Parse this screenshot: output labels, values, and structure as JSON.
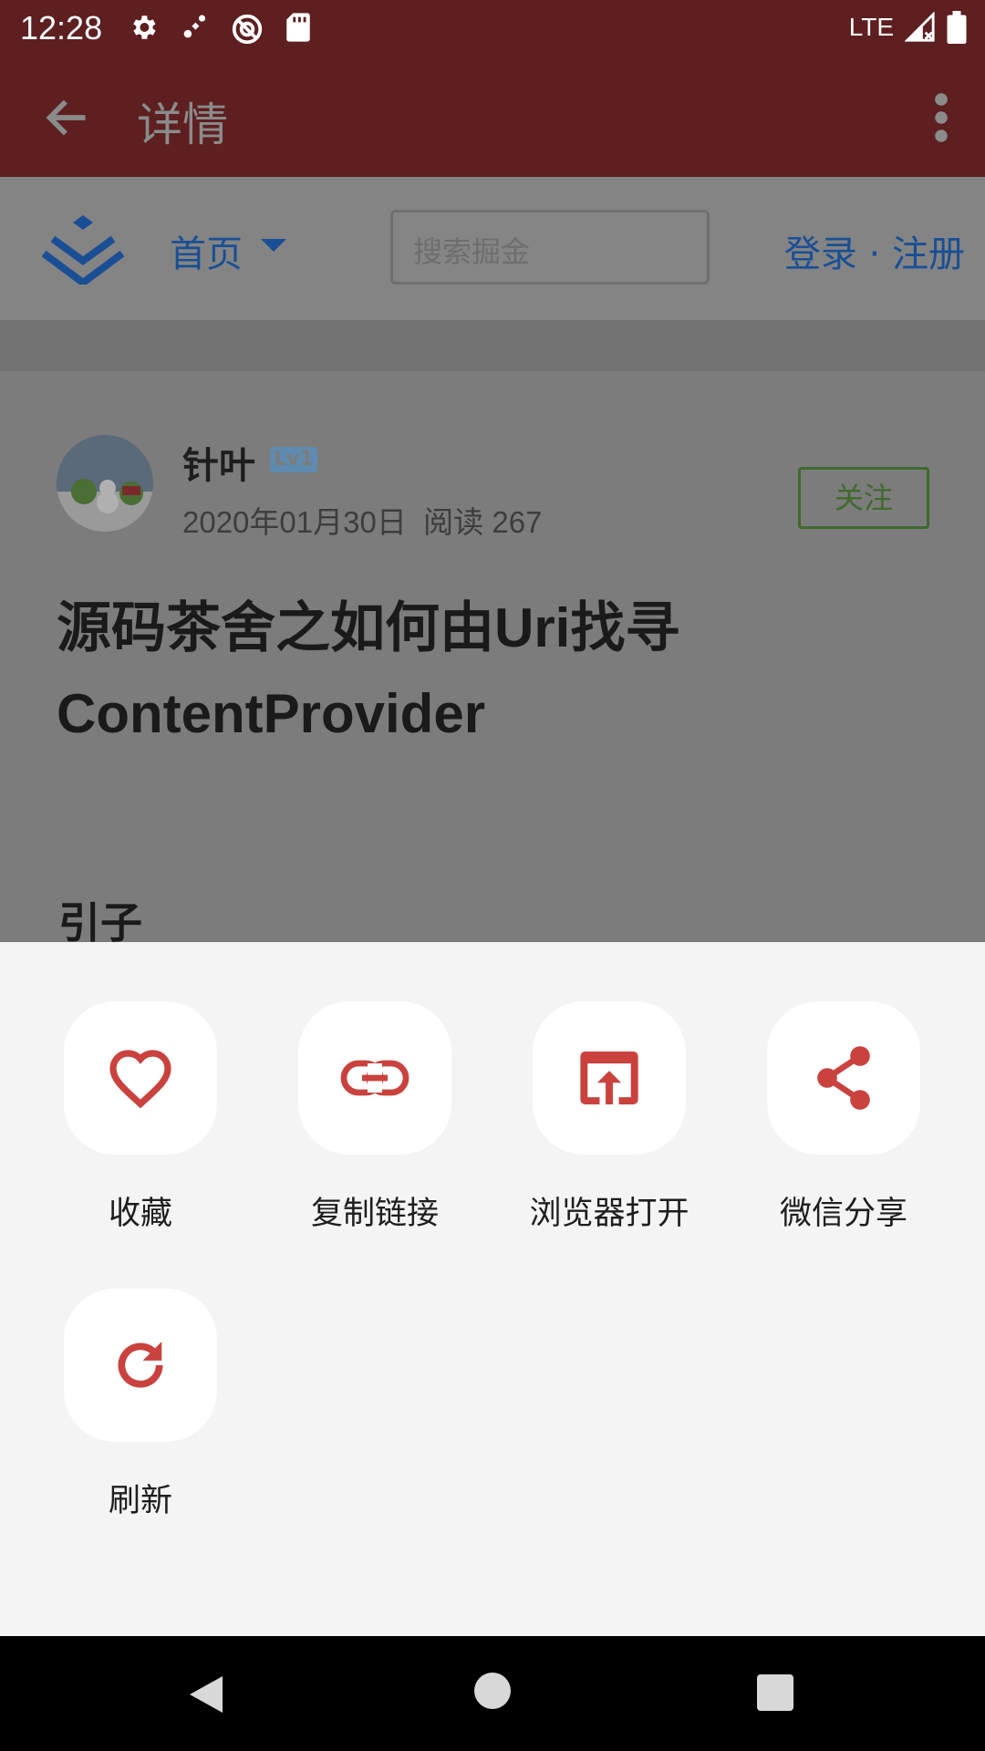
{
  "status_bar": {
    "time": "12:28",
    "network": "LTE",
    "icons_left": [
      "settings-icon",
      "signal-icon",
      "vpn-icon",
      "sd-card-icon"
    ],
    "icons_right": [
      "cell-signal-icon",
      "battery-icon"
    ]
  },
  "toolbar": {
    "title": "详情",
    "back_icon": "arrow-back-icon",
    "menu_icon": "more-vert-icon"
  },
  "site_header": {
    "home_label": "首页",
    "search_placeholder": "搜索掘金",
    "auth_label": "登录 · 注册"
  },
  "article": {
    "author_name": "针叶",
    "level_badge": "Lv1",
    "date": "2020年01月30日",
    "read_label": "阅读 267",
    "follow_label": "关注",
    "title": "源码茶舍之如何由Uri找寻ContentProvider",
    "section_heading": "引子"
  },
  "sheet": {
    "actions": [
      {
        "label": "收藏",
        "icon": "heart-icon"
      },
      {
        "label": "复制链接",
        "icon": "link-icon"
      },
      {
        "label": "浏览器打开",
        "icon": "open-in-browser-icon"
      },
      {
        "label": "微信分享",
        "icon": "share-icon"
      },
      {
        "label": "刷新",
        "icon": "refresh-icon"
      }
    ]
  },
  "colors": {
    "toolbar_bg": "#5e1f21",
    "accent_icon": "#c9423e",
    "sheet_bg": "#f4f4f4",
    "link_blue": "#1a4f95"
  }
}
